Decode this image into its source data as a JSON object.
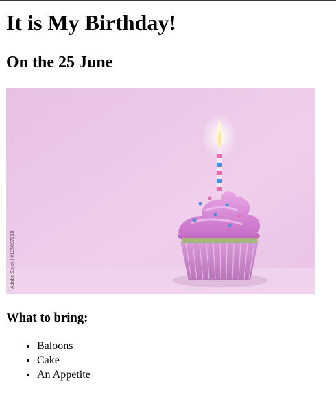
{
  "page": {
    "title": "It is My Birthday!",
    "date_heading": "On the 25 June",
    "image": {
      "description": "cupcake-with-candle",
      "watermark_text": "Adobe Stock | #105027238",
      "background_color": "#eac6e6",
      "frosting_color": "#d58ad6",
      "wrapper_color": "#cf8fd0",
      "candle_stripe_colors": [
        "#e26fae",
        "#4a8fd9"
      ]
    },
    "bring_heading": "What to bring:",
    "bring_items": [
      "Baloons",
      "Cake",
      "An Appetite"
    ]
  }
}
